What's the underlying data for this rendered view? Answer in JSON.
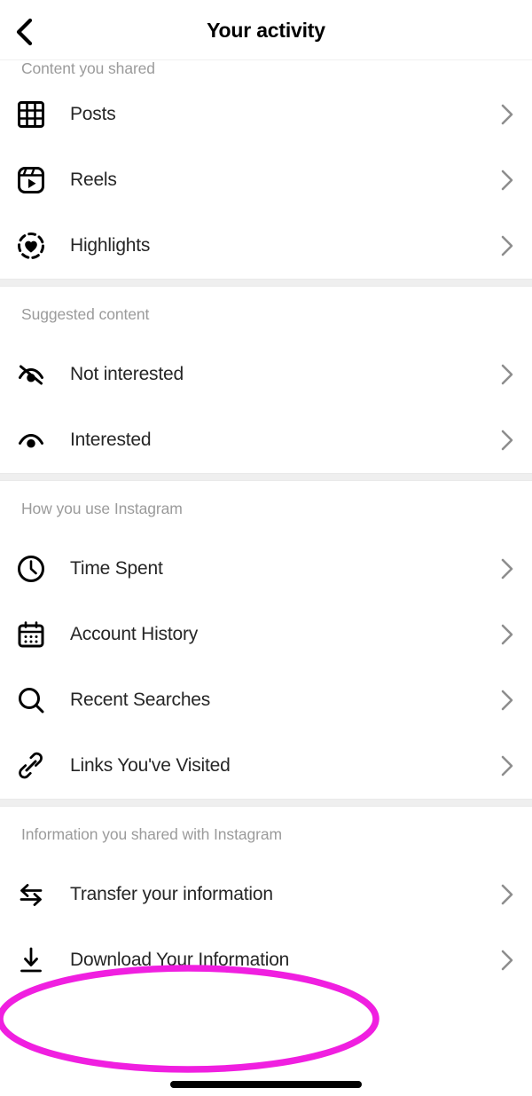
{
  "header": {
    "title": "Your activity",
    "back_icon": "chevron-left-icon"
  },
  "sections": [
    {
      "id": "content-you-shared",
      "title": "Content you shared",
      "items": [
        {
          "label": "Posts",
          "icon": "grid-icon"
        },
        {
          "label": "Reels",
          "icon": "reels-icon"
        },
        {
          "label": "Highlights",
          "icon": "highlights-heart-icon"
        }
      ]
    },
    {
      "id": "suggested-content",
      "title": "Suggested content",
      "items": [
        {
          "label": "Not interested",
          "icon": "eye-off-icon"
        },
        {
          "label": "Interested",
          "icon": "eye-icon"
        }
      ]
    },
    {
      "id": "how-you-use-instagram",
      "title": "How you use Instagram",
      "items": [
        {
          "label": "Time Spent",
          "icon": "clock-icon"
        },
        {
          "label": "Account History",
          "icon": "calendar-icon"
        },
        {
          "label": "Recent Searches",
          "icon": "search-icon"
        },
        {
          "label": "Links You've Visited",
          "icon": "link-icon"
        }
      ]
    },
    {
      "id": "information-you-shared",
      "title": "Information you shared with Instagram",
      "items": [
        {
          "label": "Transfer your information",
          "icon": "transfer-arrows-icon"
        },
        {
          "label": "Download Your Information",
          "icon": "download-icon"
        }
      ]
    }
  ],
  "chevron_icon": "chevron-right-icon",
  "annotation": {
    "shape": "ellipse",
    "target": "Download Your Information",
    "color": "#F01FE0"
  },
  "colors": {
    "background": "#FFFFFF",
    "label_text": "#262626",
    "section_text": "#9B9B9B",
    "chevron": "#8E8E8E",
    "divider": "#EFEFEF",
    "annotation": "#F01FE0",
    "home_indicator": "#000000"
  }
}
